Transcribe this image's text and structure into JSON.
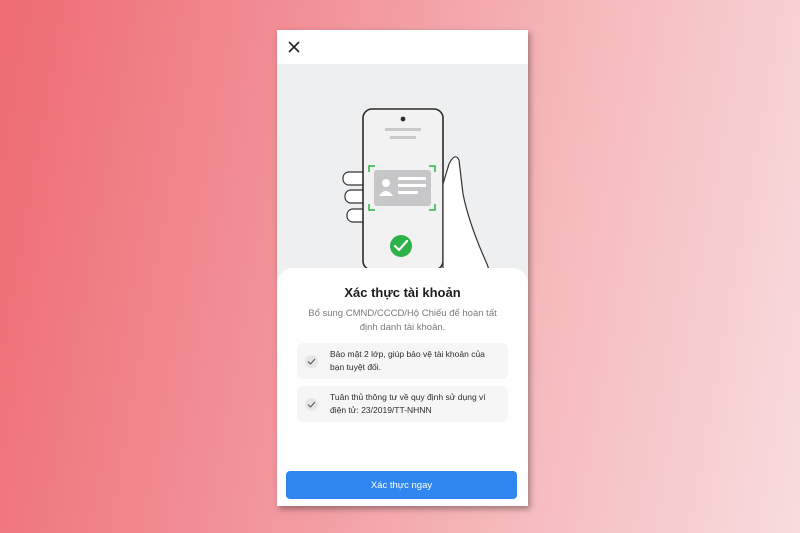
{
  "header": {
    "close_icon": "close-icon"
  },
  "hero": {
    "illustration": "hand-holding-phone-scanning-id-card",
    "check_color": "#2db24a"
  },
  "card": {
    "title": "Xác thực tài khoản",
    "description": "Bổ sung CMND/CCCD/Hộ Chiếu để hoàn tất định danh tài khoản.",
    "benefits": [
      {
        "text": "Bảo mật 2 lớp, giúp bảo vệ tài khoản của bạn tuyệt đối."
      },
      {
        "text": "Tuân thủ thông tư về quy định sử dụng ví điện tử: 23/2019/TT-NHNN"
      }
    ]
  },
  "cta": {
    "label": "Xác thực ngay",
    "color": "#2f86f0"
  }
}
